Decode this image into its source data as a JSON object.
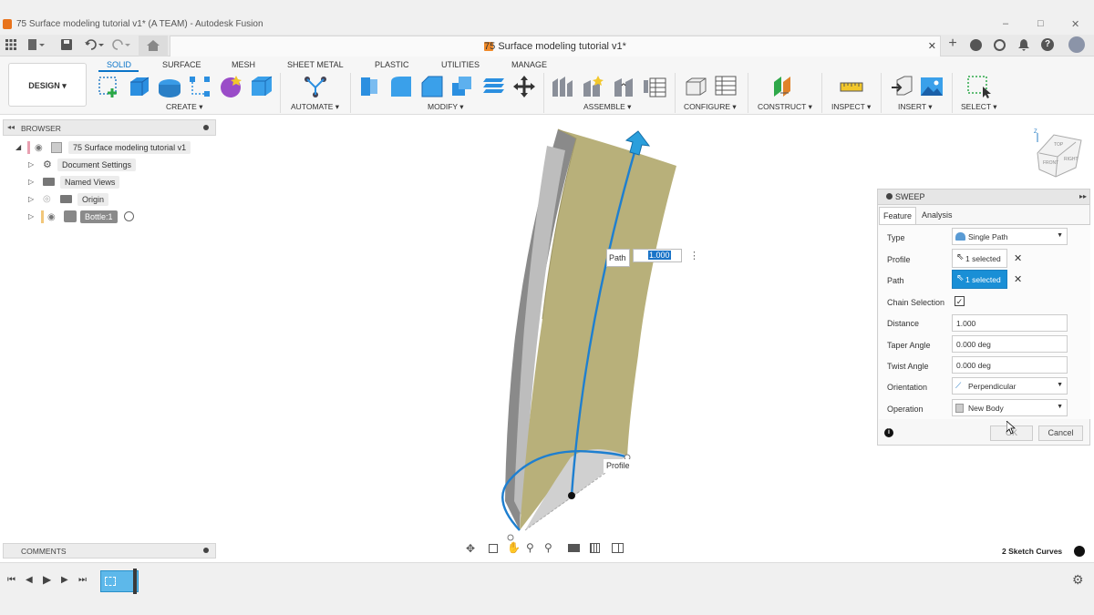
{
  "window": {
    "title": "75 Surface modeling tutorial v1* (A TEAM) - Autodesk Fusion",
    "minimize": "‒",
    "maximize": "□",
    "close": "✕"
  },
  "document_tab": {
    "title": "75 Surface modeling tutorial v1*",
    "close": "✕"
  },
  "ribbon": {
    "design_label": "DESIGN ▾",
    "tabs": [
      "SOLID",
      "SURFACE",
      "MESH",
      "SHEET METAL",
      "PLASTIC",
      "UTILITIES",
      "MANAGE"
    ],
    "groups": [
      "CREATE ▾",
      "AUTOMATE ▾",
      "MODIFY ▾",
      "ASSEMBLE ▾",
      "CONFIGURE ▾",
      "CONSTRUCT ▾",
      "INSPECT ▾",
      "INSERT ▾",
      "SELECT ▾"
    ]
  },
  "browser": {
    "header": "BROWSER",
    "items": [
      {
        "label": "75 Surface modeling tutorial v1"
      },
      {
        "label": "Document Settings"
      },
      {
        "label": "Named Views"
      },
      {
        "label": "Origin"
      },
      {
        "label": "Bottle:1"
      }
    ]
  },
  "canvas": {
    "path_label": "Path",
    "path_value": "1.000",
    "profile_label": "Profile"
  },
  "sweep": {
    "title": "SWEEP",
    "tabs": [
      "Feature",
      "Analysis"
    ],
    "rows": {
      "type_label": "Type",
      "type_value": "Single Path",
      "profile_label": "Profile",
      "profile_value": "1 selected",
      "path_label": "Path",
      "path_value": "1 selected",
      "chain_label": "Chain Selection",
      "distance_label": "Distance",
      "distance_value": "1.000",
      "taper_label": "Taper Angle",
      "taper_value": "0.000 deg",
      "twist_label": "Twist Angle",
      "twist_value": "0.000 deg",
      "orientation_label": "Orientation",
      "orientation_value": "Perpendicular",
      "operation_label": "Operation",
      "operation_value": "New Body"
    },
    "ok": "OK",
    "cancel": "Cancel"
  },
  "comments": {
    "header": "COMMENTS"
  },
  "status": {
    "selection": "2 Sketch Curves"
  },
  "colors": {
    "accent": "#0a74c8",
    "selected": "#1a8fd6",
    "surface": "#b8b07a"
  }
}
